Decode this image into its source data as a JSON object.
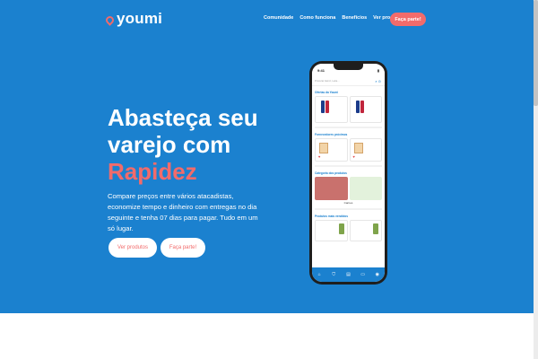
{
  "brand": {
    "name": "youmi",
    "accent_color": "#f26b6b",
    "primary_color": "#1b81cf"
  },
  "nav": {
    "links": [
      "Comunidade",
      "Como funciona",
      "Benefícios",
      "Ver produtos"
    ],
    "cta": "Faça parte!"
  },
  "hero": {
    "title_line1": "Abasteça seu",
    "title_line2": "varejo com",
    "title_accent": "Rapidez",
    "description": "Compare preços entre vários atacadistas, economize tempo e dinheiro com entregas no dia seguinte e tenha 07 dias para pagar. Tudo em um só lugar.",
    "btn_products": "Ver produtos",
    "btn_join": "Faça parte!"
  },
  "phone": {
    "time": "9:41",
    "search_placeholder": "Procurar Heinz, Leite...",
    "sections": {
      "offers": "Ofertas da Youmi",
      "suppliers": "Fornecedores próximos",
      "categories": "Categoria dos produtos",
      "categories_item": "Carnes",
      "best_sellers": "Produtos mais vendidos"
    },
    "bottom_nav_icons": [
      "home-icon",
      "cart-icon",
      "orders-icon",
      "wallet-icon",
      "profile-icon"
    ]
  }
}
